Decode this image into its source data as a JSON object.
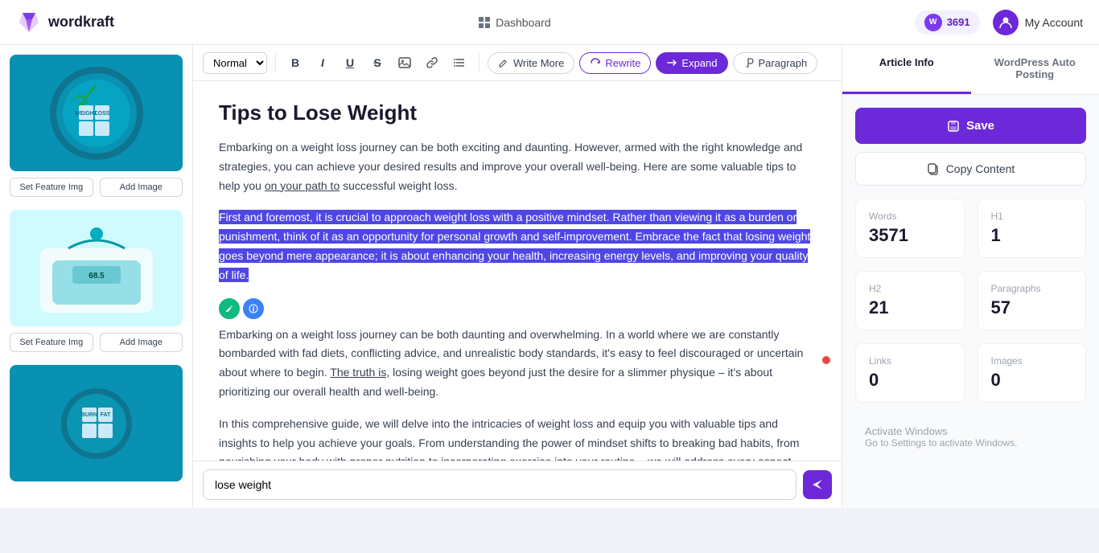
{
  "app": {
    "name": "wordkraft",
    "logo_letter": "W"
  },
  "nav": {
    "dashboard_label": "Dashboard",
    "credits": "3691",
    "credits_letter": "W",
    "account_label": "My Account"
  },
  "toolbar": {
    "style_select": "Normal",
    "write_more_label": "Write More",
    "rewrite_label": "Rewrite",
    "expand_label": "Expand",
    "paragraph_label": "Paragraph"
  },
  "editor": {
    "title": "Tips to Lose Weight",
    "para1": "Embarking on a weight loss journey can be both exciting and daunting. However, armed with the right knowledge and strategies, you can achieve your desired results and improve your overall well-being. Here are some valuable tips to help you ",
    "para1_link": "on your path to",
    "para1_end": " successful weight loss.",
    "para2_highlight": "First and foremost, it is crucial to approach weight loss with a positive mindset. Rather than viewing it as a burden or punishment, think of it as an opportunity for personal growth and self-improvement. Embrace the fact that losing weight goes beyond mere appearance; it is about enhancing your health, increasing energy levels, and improving your quality of life.",
    "para3": "Embarking on a weight loss journey can be both daunting and overwhelming. In a world where we are constantly bombarded with fad diets, conflicting advice, and unrealistic body standards, it's easy to feel discouraged or uncertain about where to begin. ",
    "para3_link": "The truth is,",
    "para3_end": " losing weight goes beyond just the desire for a slimmer physique – it's about prioritizing our overall health and well-being.",
    "para4": "In this comprehensive guide, we will delve into the intricacies of weight loss and equip you with valuable tips and insights to help you achieve your goals. From understanding the power of mindset shifts to breaking bad habits, from nourishing your body with proper nutrition to incorporating exercise into your routine – we will address every aspect necessary for successful"
  },
  "bottom_input": {
    "value": "lose weight",
    "placeholder": "lose weight"
  },
  "right_sidebar": {
    "tab_article_info": "Article Info",
    "tab_wordpress": "WordPress Auto Posting",
    "save_label": "Save",
    "copy_label": "Copy Content",
    "stats": {
      "words_label": "Words",
      "words_value": "3571",
      "h1_label": "H1",
      "h1_value": "1",
      "h2_label": "H2",
      "h2_value": "21",
      "paragraphs_label": "Paragraphs",
      "paragraphs_value": "57",
      "links_label": "Links",
      "links_value": "0",
      "images_label": "Images",
      "images_value": "0"
    },
    "activate_title": "Activate Windows",
    "activate_sub": "Go to Settings to activate Windows."
  },
  "images": [
    {
      "alt": "weight loss plate",
      "type": "teal"
    },
    {
      "alt": "weight scale",
      "type": "scale"
    },
    {
      "alt": "burn fat plate",
      "type": "burnfat"
    }
  ],
  "image_buttons": {
    "set_feature": "Set Feature Img",
    "add_image": "Add Image"
  }
}
